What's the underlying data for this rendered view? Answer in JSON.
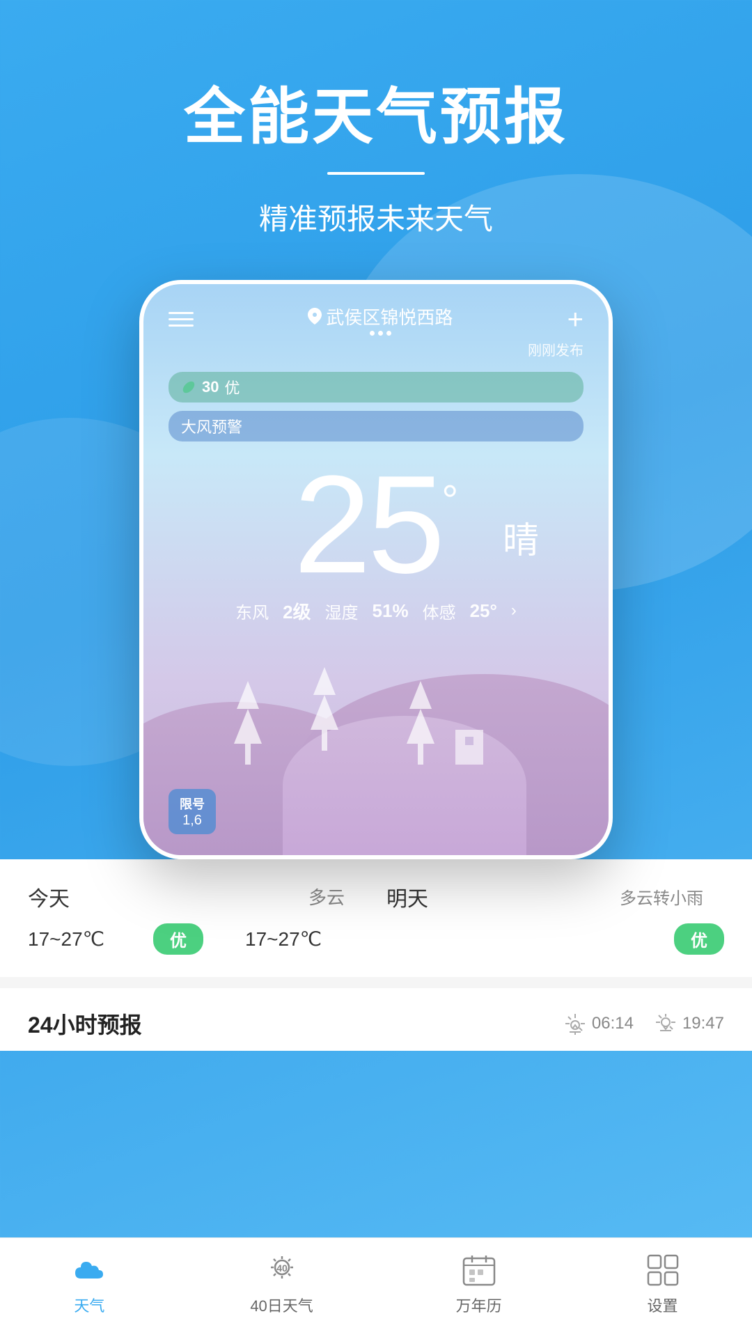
{
  "app": {
    "title": "全能天气预报"
  },
  "header": {
    "main_title": "全能天气预报",
    "divider": true,
    "sub_title": "精准预报未来天气"
  },
  "phone": {
    "location": "武侯区锦悦西路",
    "update_time": "刚刚发布",
    "aqi": {
      "number": "30",
      "label": "优"
    },
    "warning": "大风预警",
    "temperature": "25",
    "condition": "晴",
    "wind": "东风",
    "wind_level": "2级",
    "humidity_label": "湿度",
    "humidity": "51%",
    "feel_label": "体感",
    "feel_temp": "25°",
    "license": {
      "label": "限号",
      "number": "1,6"
    }
  },
  "today_section": {
    "today_label": "今天",
    "today_condition": "多云",
    "today_temp": "17~27℃",
    "today_air": "优",
    "tomorrow_label": "明天",
    "tomorrow_condition": "多云转小雨",
    "tomorrow_temp": "17~27℃",
    "tomorrow_air": "优"
  },
  "forecast": {
    "title": "24小时预报",
    "sunrise": "06:14",
    "sunset": "19:47"
  },
  "nav": {
    "weather_label": "天气",
    "forecast40_label": "40日天气",
    "calendar_label": "万年历",
    "settings_label": "设置",
    "forecast40_num": "40"
  }
}
